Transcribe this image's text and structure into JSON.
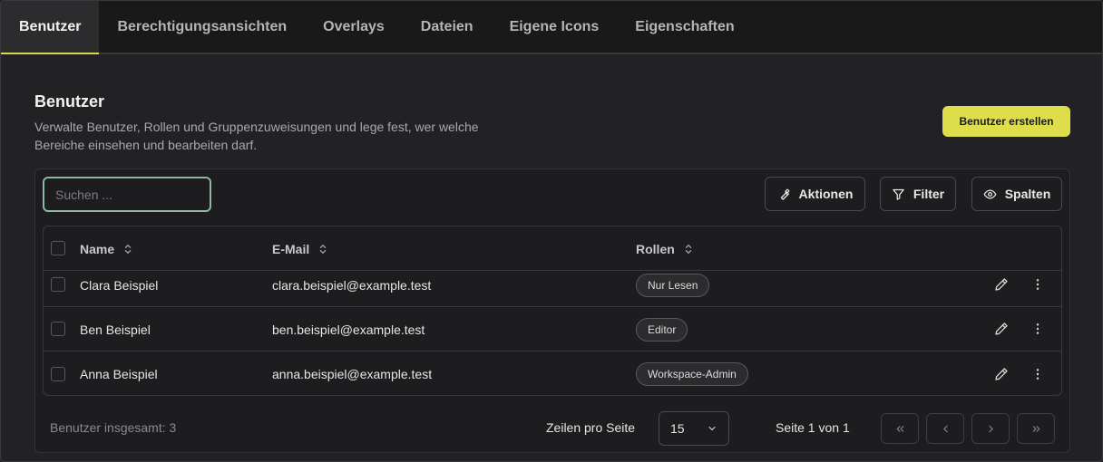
{
  "tabs": [
    {
      "label": "Benutzer",
      "active": true
    },
    {
      "label": "Berechtigungsansichten"
    },
    {
      "label": "Overlays"
    },
    {
      "label": "Dateien"
    },
    {
      "label": "Eigene Icons"
    },
    {
      "label": "Eigenschaften"
    }
  ],
  "header": {
    "title": "Benutzer",
    "description": "Verwalte Benutzer, Rollen und Gruppenzuweisungen und lege fest, wer welche Bereiche einsehen und bearbeiten darf.",
    "create_label": "Benutzer erstellen"
  },
  "toolbar": {
    "search_placeholder": "Suchen ...",
    "actions_label": "Aktionen",
    "filter_label": "Filter",
    "columns_label": "Spalten"
  },
  "table": {
    "columns": [
      "Name",
      "E-Mail",
      "Rollen"
    ],
    "rows": [
      {
        "name": "Clara Beispiel",
        "email": "clara.beispiel@example.test",
        "role": "Nur Lesen"
      },
      {
        "name": "Ben Beispiel",
        "email": "ben.beispiel@example.test",
        "role": "Editor"
      },
      {
        "name": "Anna Beispiel",
        "email": "anna.beispiel@example.test",
        "role": "Workspace-Admin"
      }
    ]
  },
  "footer": {
    "total": "Benutzer insgesamt: 3",
    "rows_per_page_label": "Zeilen pro Seite",
    "rows_per_page_value": "15",
    "page_info": "Seite 1 von 1"
  },
  "colors": {
    "accent": "#dede4a",
    "background": "#222224",
    "focus_ring": "#8fb8a3"
  },
  "icons": [
    "wrench-icon",
    "filter-icon",
    "eye-icon",
    "sort-icon",
    "pencil-icon",
    "more-vertical-icon",
    "chevron-down-icon",
    "chevrons-left-icon",
    "chevron-left-icon",
    "chevron-right-icon",
    "chevrons-right-icon"
  ]
}
